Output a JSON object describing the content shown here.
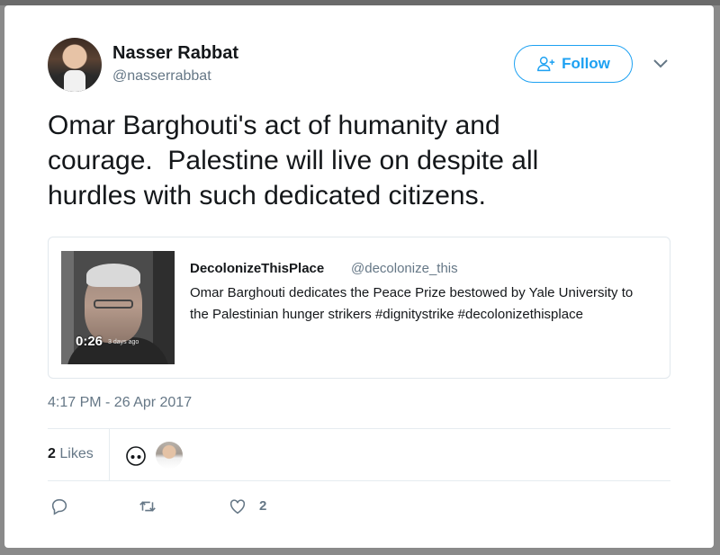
{
  "author": {
    "name": "Nasser Rabbat",
    "handle": "@nasserrabbat"
  },
  "follow_button": {
    "label": "Follow",
    "icon": "add-person-icon",
    "color": "#1da1f2"
  },
  "tweet": {
    "text": "Omar Barghouti's act of humanity and\ncourage.  Palestine will live on despite all\nhurdles with such dedicated citizens.",
    "timestamp": "4:17 PM - 26 Apr 2017"
  },
  "quoted_tweet": {
    "author_name": "DecolonizeThisPlace",
    "author_handle": "@decolonize_this",
    "text": "Omar Barghouti dedicates the Peace Prize bestowed by Yale University to the Palestinian hunger strikers #dignitystrike #decolonizethisplace",
    "video_duration": "0:26",
    "video_overlay_text": "3 days ago"
  },
  "engagement": {
    "likes_count": "2",
    "likes_label": "Likes"
  },
  "actions": {
    "like_count": "2"
  }
}
